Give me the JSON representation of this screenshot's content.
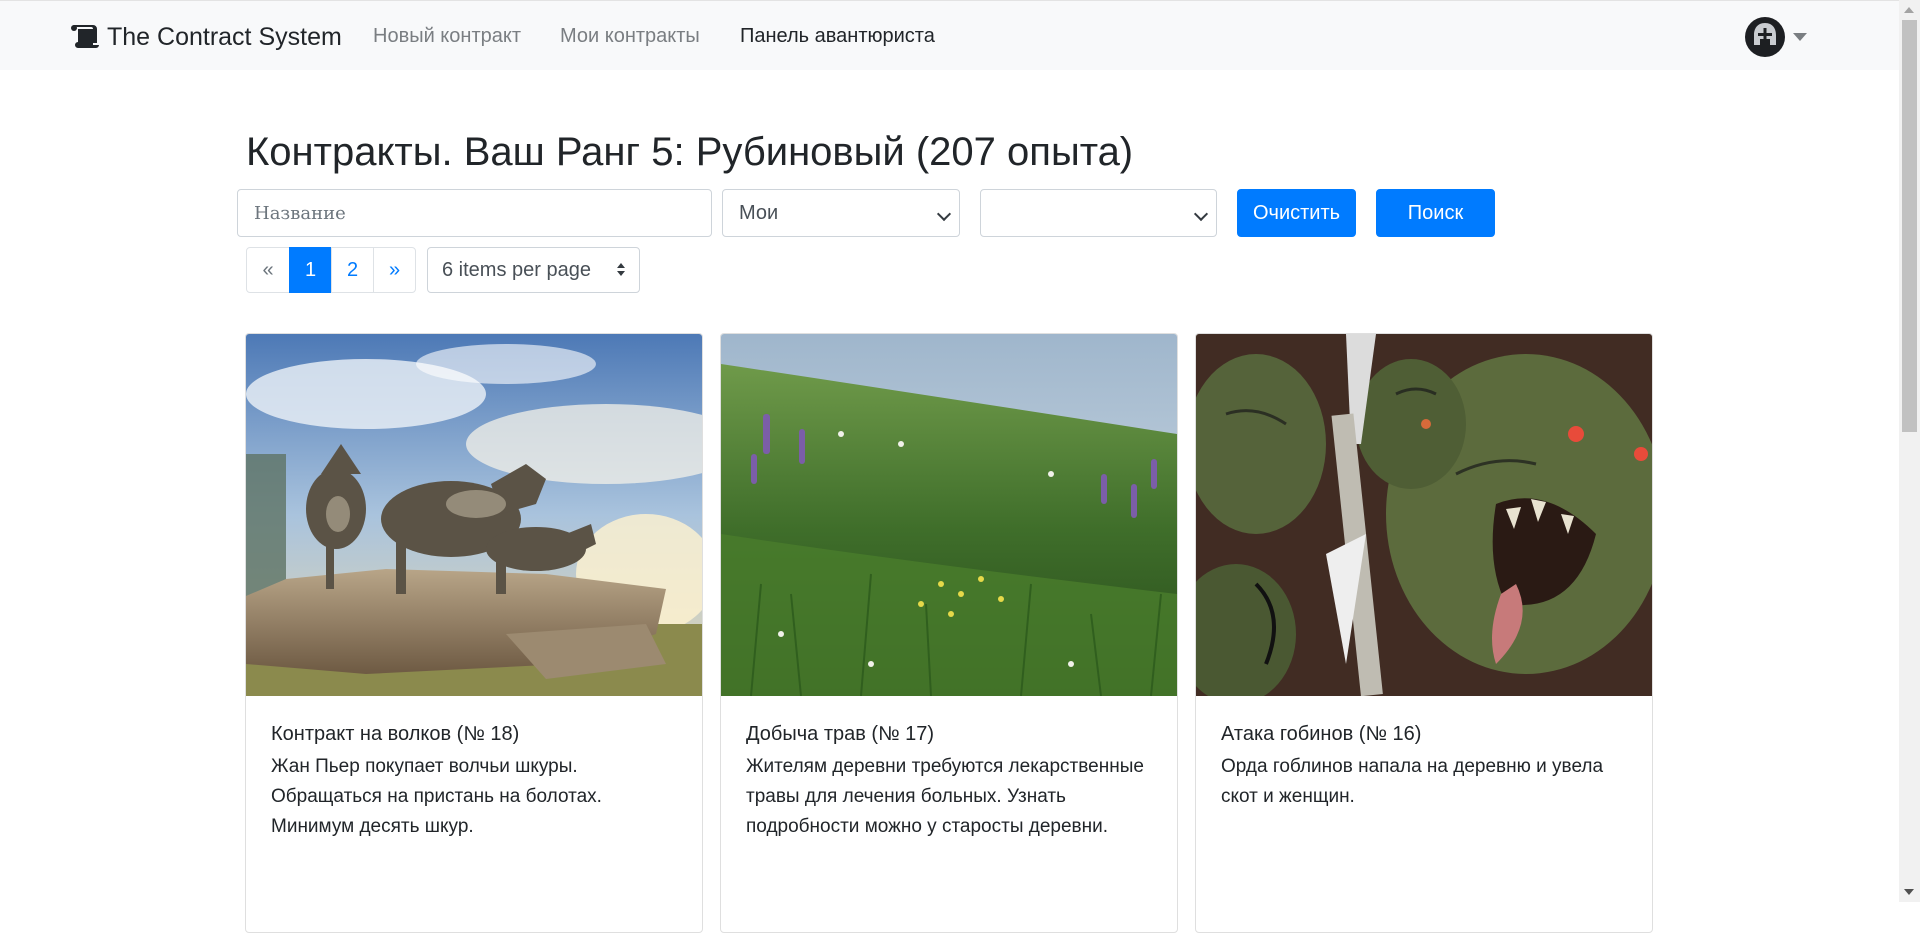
{
  "navbar": {
    "brand": "The Contract System",
    "brand_icon": "scroll-icon",
    "links": [
      {
        "label": "Новый контракт",
        "active": false
      },
      {
        "label": "Мои контракты",
        "active": false
      },
      {
        "label": "Панель авантюриста",
        "active": true
      }
    ],
    "avatar_icon": "helmet-icon"
  },
  "page": {
    "title": "Контракты. Ваш Ранг 5: Рубиновый (207 опыта)"
  },
  "filters": {
    "name_placeholder": "Название",
    "owner_select_value": "Мои",
    "second_select_value": "",
    "clear_label": "Очистить",
    "search_label": "Поиск"
  },
  "pagination": {
    "prev": "«",
    "pages": [
      "1",
      "2"
    ],
    "current_page": "1",
    "next": "»",
    "per_page": "6 items per page"
  },
  "cards": [
    {
      "title": "Контракт на волков (№ 18)",
      "text": "Жан Пьер покупает волчьи шкуры. Обращаться на пристань на болотах. Минимум десять шкур.",
      "image": "wolves-on-rock"
    },
    {
      "title": "Добыча трав (№ 17)",
      "text": "Жителям деревни требуются лекарственные травы для лечения больных. Узнать подробности можно у старосты деревни.",
      "image": "grass-meadow"
    },
    {
      "title": "Атака гобинов (№ 16)",
      "text": "Орда гоблинов напала на деревню и увела скот и женщин.",
      "image": "goblin-horde"
    }
  ],
  "colors": {
    "primary": "#007bff",
    "navbar_bg": "#f8f9fa",
    "text": "#212529",
    "muted_link": "#7a7e82"
  }
}
